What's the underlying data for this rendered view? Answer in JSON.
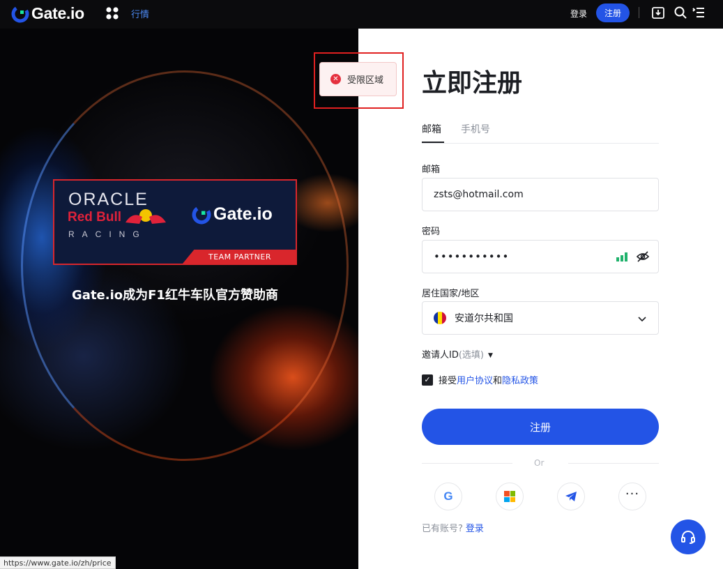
{
  "nav": {
    "logo_text": "Gate.io",
    "markets_label": "行情",
    "login_label": "登录",
    "register_label": "注册"
  },
  "hero": {
    "card_oracle": "ORACLE",
    "card_redbull": "Red Bull",
    "card_racing": "RACING",
    "card_gate": "Gate.io",
    "card_team_partner": "TEAM PARTNER",
    "caption": "Gate.io成为F1红牛车队官方赞助商"
  },
  "toast": {
    "text": "受限区域"
  },
  "form": {
    "title": "立即注册",
    "tabs": [
      {
        "label": "邮箱",
        "active": true
      },
      {
        "label": "手机号",
        "active": false
      }
    ],
    "email_label": "邮箱",
    "email_value": "zsts@hotmail.com",
    "password_label": "密码",
    "password_value": "•••••••••••",
    "country_label": "居住国家/地区",
    "country_value": "安道尔共和国",
    "invite_label": "邀请人ID",
    "invite_optional": "(选填)",
    "agree_prefix": "接受",
    "agree_terms": "用户协议",
    "agree_and": "和",
    "agree_privacy": "隐私政策",
    "submit_label": "注册",
    "or_text": "Or",
    "have_account": "已有账号?",
    "login_link": "登录"
  },
  "status_url": "https://www.gate.io/zh/price",
  "colors": {
    "accent": "#2354e6",
    "nav_bg": "#0b0b0d",
    "error": "#e5303e"
  }
}
